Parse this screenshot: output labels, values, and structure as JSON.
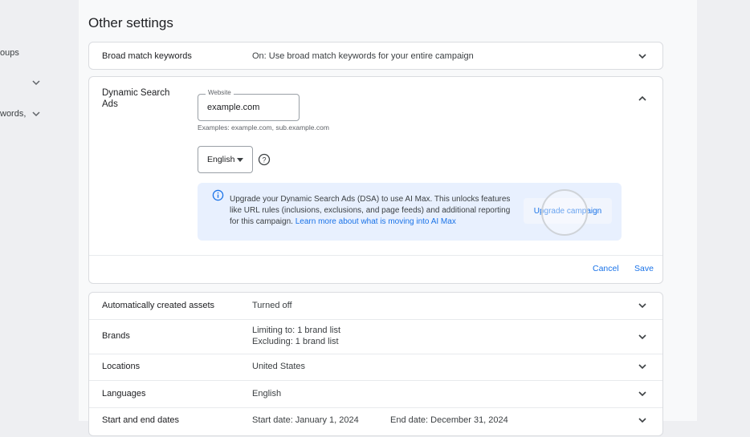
{
  "left_nav": {
    "item_1": "oups",
    "item_3": "words,"
  },
  "page": {
    "title": "Other settings"
  },
  "broad_match": {
    "label": "Broad match keywords",
    "value": "On: Use broad match keywords for your entire campaign"
  },
  "dsa": {
    "label": "Dynamic Search Ads",
    "website_label": "Website",
    "website_value": "example.com",
    "website_helper": "Examples: example.com, sub.example.com",
    "language_value": "English",
    "banner": {
      "text": "Upgrade your Dynamic Search Ads (DSA) to use AI Max. This unlocks features like URL rules (inclusions, exclusions, and page feeds) and additional reporting for this campaign.",
      "link": "Learn more about what is moving into AI Max",
      "button": "Upgrade campaign"
    },
    "cancel": "Cancel",
    "save": "Save"
  },
  "rows": {
    "auto_assets": {
      "label": "Automatically created assets",
      "value": "Turned off"
    },
    "brands": {
      "label": "Brands",
      "value_1": "Limiting to: 1 brand list",
      "value_2": "Excluding: 1 brand list"
    },
    "locations": {
      "label": "Locations",
      "value": "United States"
    },
    "languages": {
      "label": "Languages",
      "value": "English"
    },
    "dates": {
      "label": "Start and end dates",
      "start": "Start date: January 1, 2024",
      "end": "End date: December 31, 2024"
    }
  },
  "colors": {
    "accent": "#1a73e8",
    "banner_bg": "#e8f0fe",
    "border": "#dadce0"
  },
  "icons": [
    "chevron-down-icon",
    "chevron-up-icon",
    "help-icon",
    "info-icon",
    "dropdown-arrow-icon"
  ]
}
